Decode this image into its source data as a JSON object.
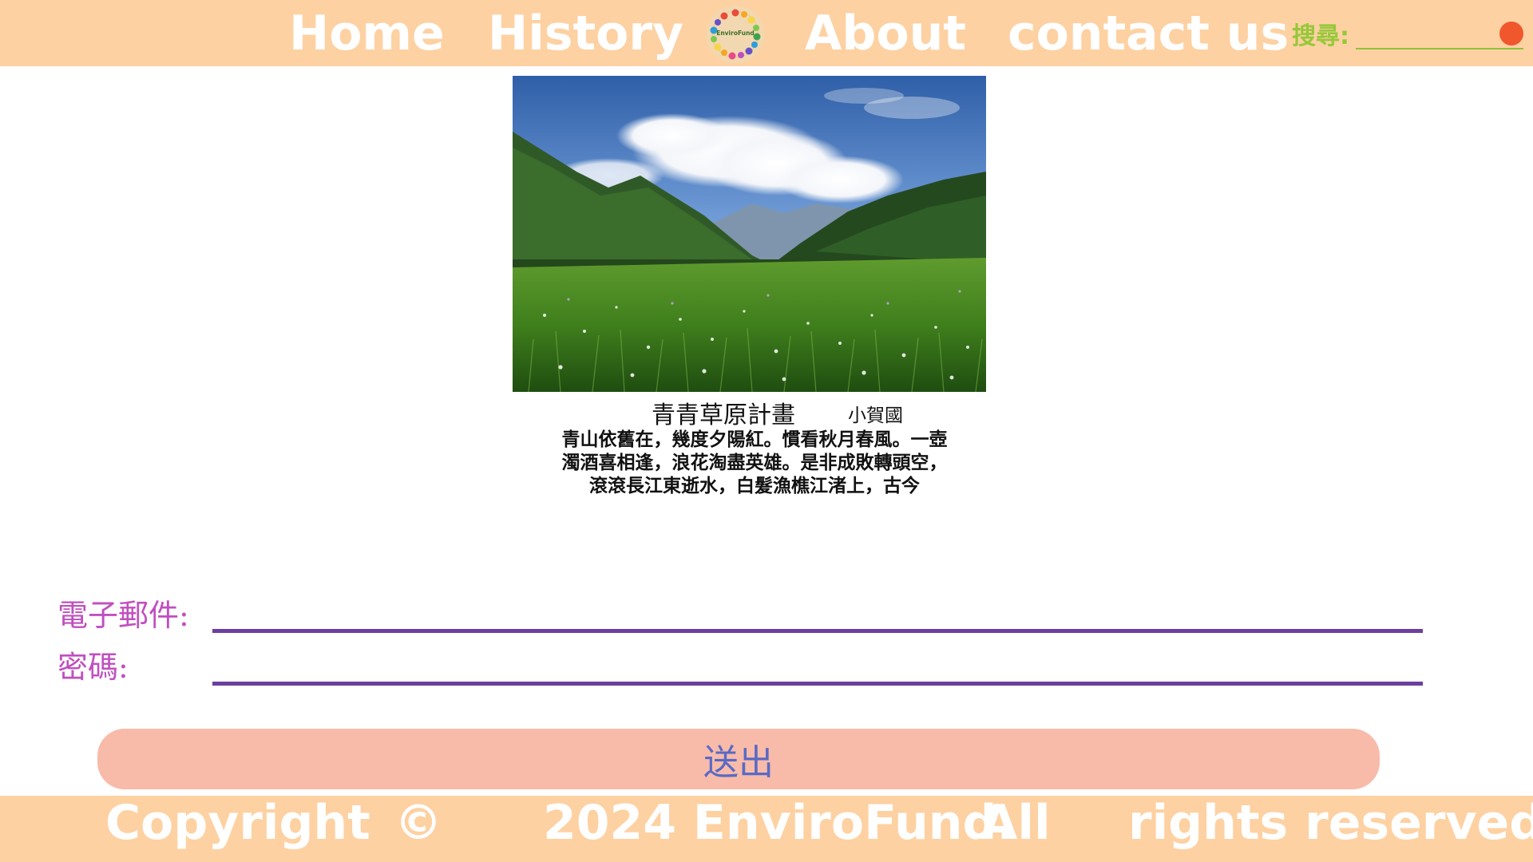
{
  "nav": {
    "home": "Home",
    "history": "History",
    "logo_text": "EnviroFund",
    "about": "About",
    "contact": "contact us"
  },
  "search": {
    "label": "搜尋:",
    "value": ""
  },
  "hero": {
    "image": "meadow-landscape-photo",
    "title": "青青草原計畫",
    "author": "小賀國",
    "poem": "青山依舊在，幾度夕陽紅。慣看秋月春風。一壺濁酒喜相逢，浪花淘盡英雄。是非成敗轉頭空，滾滾長江東逝水，白髮漁樵江渚上，古今"
  },
  "form": {
    "email_label": "電子郵件:",
    "email_value": "",
    "password_label": "密碼:",
    "password_value": "",
    "submit_label": "送出"
  },
  "footer": {
    "words": [
      "Copyright",
      "©",
      "2024 EnviroFund.",
      "All",
      "rights reserved"
    ]
  },
  "colors": {
    "header_bg": "#fed1a2",
    "nav_text": "#ffffff",
    "search_label": "#96c83a",
    "search_button": "#f0572d",
    "form_label": "#c04fc0",
    "form_underline": "#6b3fa0",
    "submit_bg": "#f8bbaa",
    "submit_text": "#5a6ac4"
  }
}
